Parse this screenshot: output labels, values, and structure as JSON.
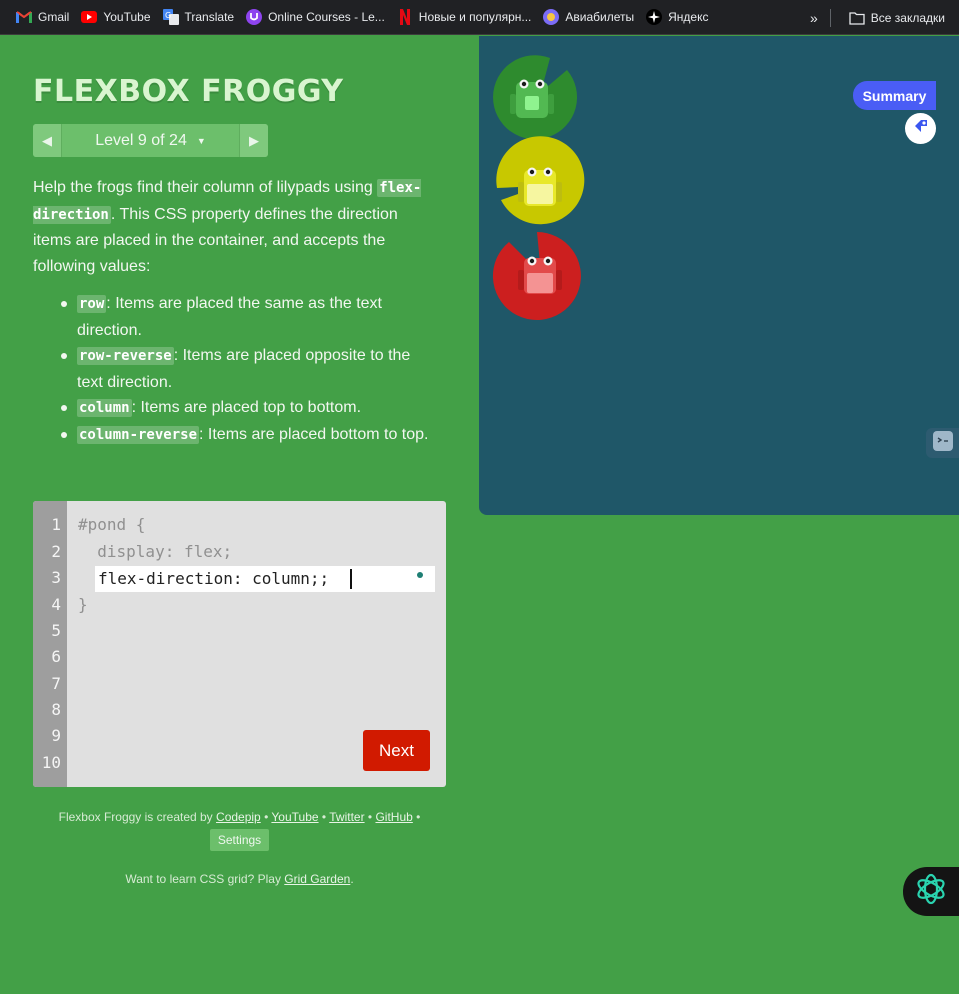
{
  "bookmarks": {
    "items": [
      {
        "label": "Gmail",
        "icon": "gmail-icon"
      },
      {
        "label": "YouTube",
        "icon": "youtube-icon"
      },
      {
        "label": "Translate",
        "icon": "translate-icon"
      },
      {
        "label": "Online Courses - Le...",
        "icon": "online-courses-icon"
      },
      {
        "label": "Новые и популярн...",
        "icon": "netflix-icon"
      },
      {
        "label": "Авиабилеты",
        "icon": "flights-icon"
      },
      {
        "label": "Яндекс",
        "icon": "yandex-icon"
      }
    ],
    "overflow_icon": "chevrons-right-icon",
    "all_bookmarks": "Все закладки"
  },
  "game": {
    "title": "FLEXBOX FROGGY",
    "level_label": "Level 9 of 24",
    "prev_icon": "arrow-left-icon",
    "next_icon": "arrow-right-icon"
  },
  "instructions": {
    "intro_1": "Help the frogs find their column of lilypads using",
    "property": "flex-direction",
    "intro_2": ". This CSS property defines the direction items are placed in the container, and accepts the following values:",
    "values": [
      {
        "code": "row",
        "desc": ": Items are placed the same as the text direction."
      },
      {
        "code": "row-reverse",
        "desc": ": Items are placed opposite to the text direction."
      },
      {
        "code": "column",
        "desc": ": Items are placed top to bottom."
      },
      {
        "code": "column-reverse",
        "desc": ": Items are placed bottom to top."
      }
    ]
  },
  "editor": {
    "line_numbers": [
      "1",
      "2",
      "3",
      "4",
      "5",
      "6",
      "7",
      "8",
      "9",
      "10"
    ],
    "line1": "#pond {",
    "line2": "  display: flex;",
    "input_value": "flex-direction: column;;",
    "line4": "}",
    "next_label": "Next"
  },
  "footer": {
    "created_by": "Flexbox Froggy is created by",
    "codepip": "Codepip",
    "youtube": "YouTube",
    "twitter": "Twitter",
    "github": "GitHub",
    "bullet": "•",
    "settings": "Settings",
    "grid_prefix": "Want to learn CSS grid? Play",
    "grid_link": "Grid Garden",
    "grid_suffix": "."
  },
  "pond": {
    "frogs": [
      {
        "color": "green",
        "lilypad": "#2e8b2e",
        "body": "#4fbf4f"
      },
      {
        "color": "yellow",
        "lilypad": "#c8c800",
        "body": "#f0f000"
      },
      {
        "color": "red",
        "lilypad": "#cc1f1f",
        "body": "#e84545"
      }
    ],
    "summary_label": "Summary",
    "extension_icon": "extension-logo-icon",
    "side_icon": "robot-face-icon",
    "ai_icon": "ai-assistant-icon"
  }
}
